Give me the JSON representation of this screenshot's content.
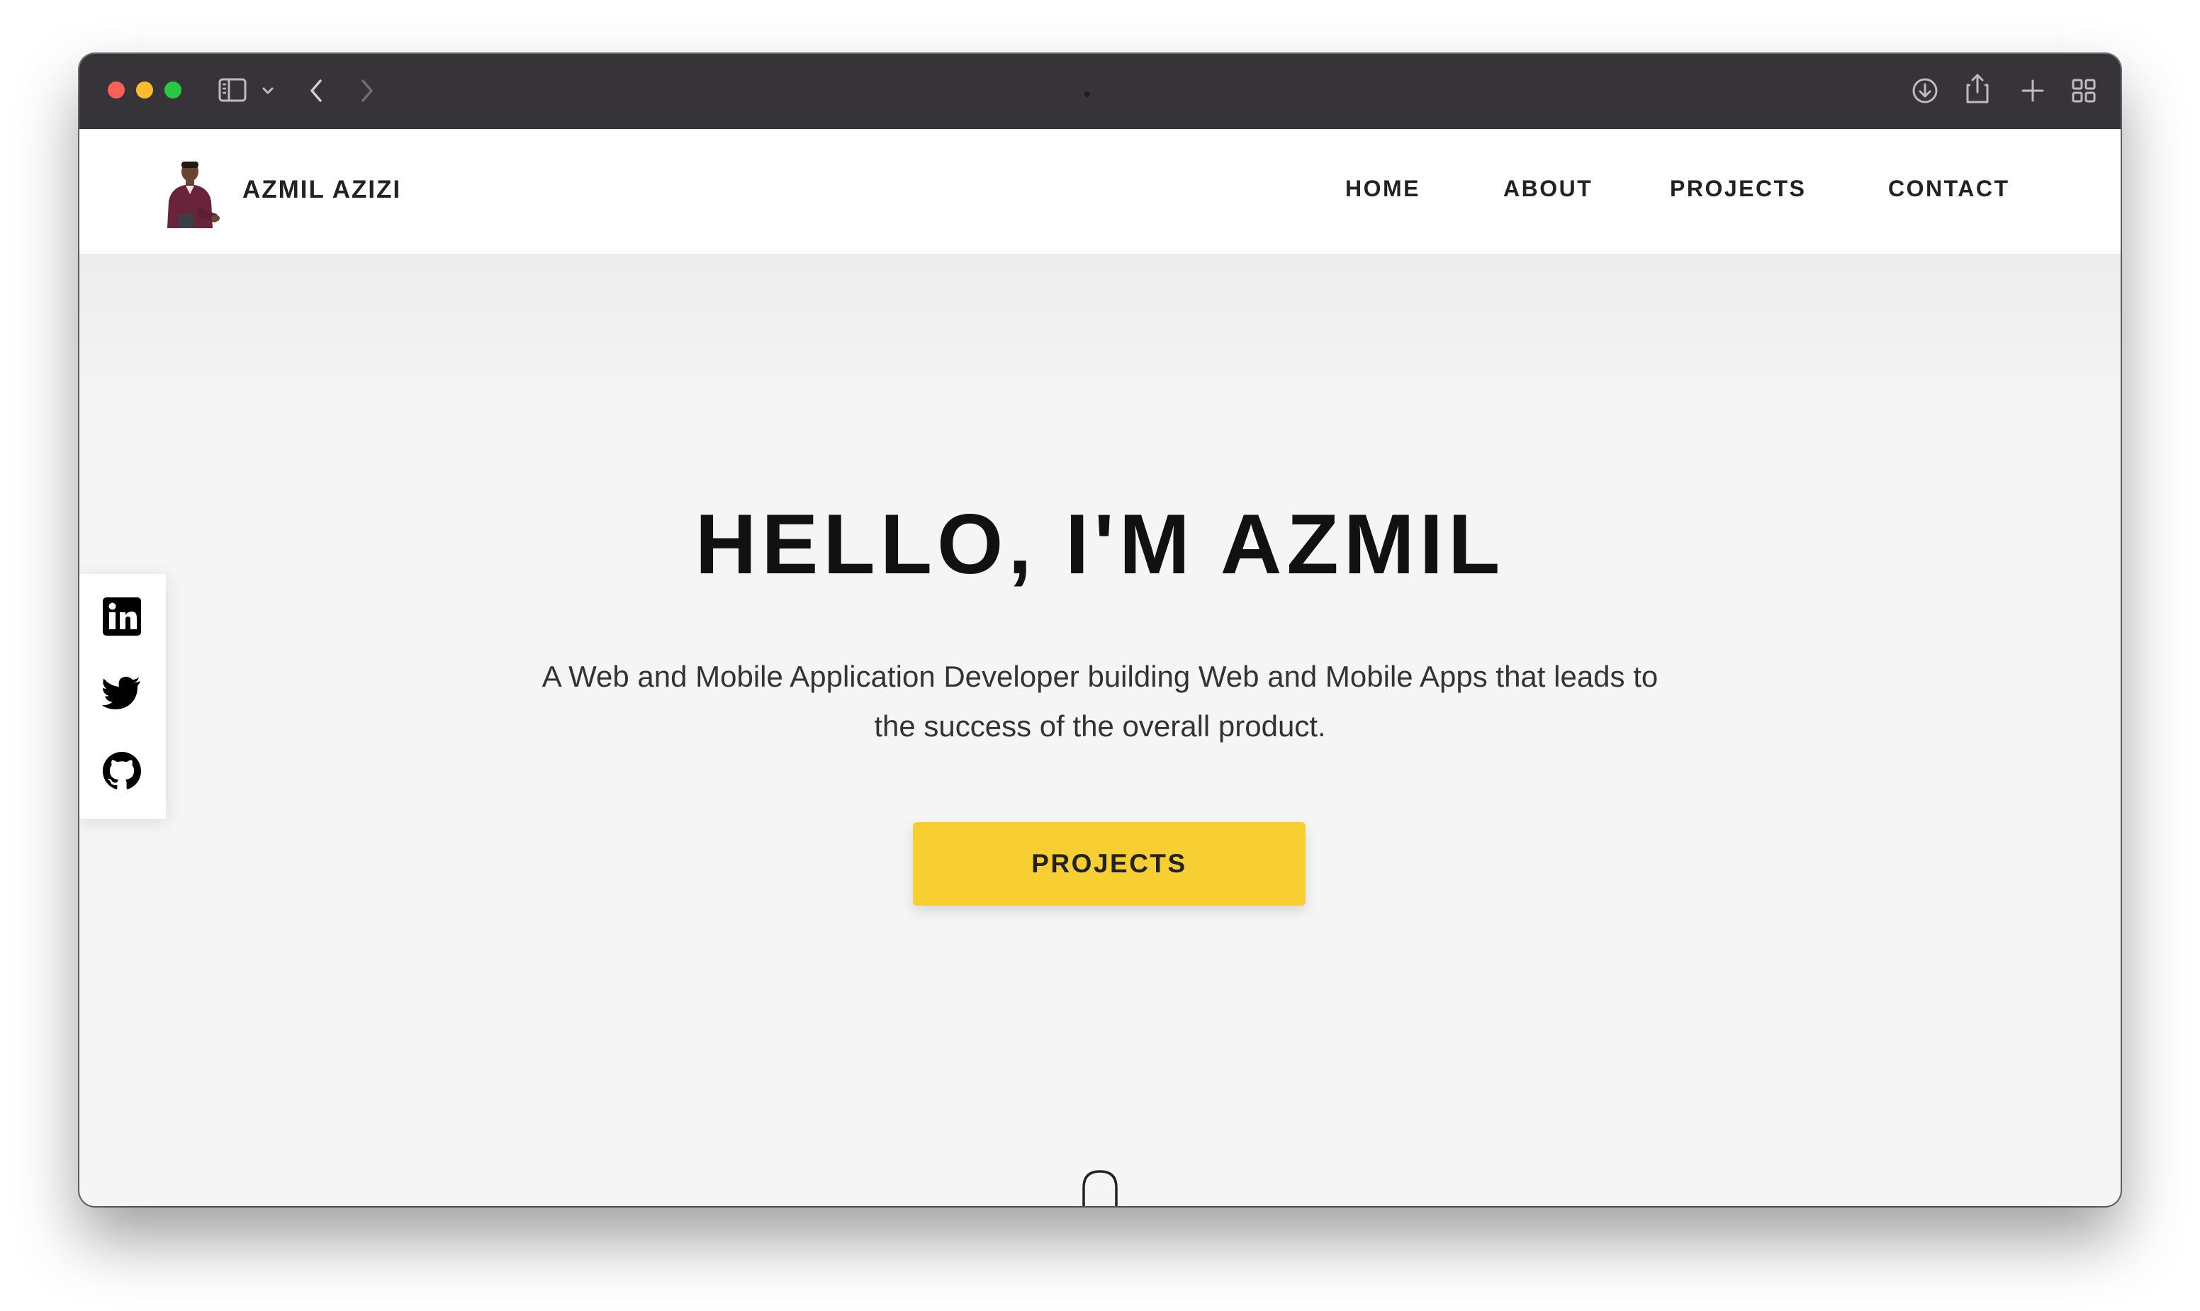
{
  "colors": {
    "toolbar": "#363438",
    "page_background": "#f5f5f5",
    "header_background": "#ffffff",
    "accent_button": "#f8cf32",
    "text_dark": "#111111"
  },
  "browser": {
    "toolbar_icons": [
      "sidebar-toggle-icon",
      "chevron-down-icon",
      "back-arrow-icon",
      "forward-arrow-icon",
      "download-icon",
      "share-icon",
      "new-tab-plus-icon",
      "tab-overview-icon"
    ]
  },
  "header": {
    "brand_name": "AZMIL AZIZI",
    "nav": {
      "home": "HOME",
      "about": "ABOUT",
      "projects": "PROJECTS",
      "contact": "CONTACT"
    }
  },
  "hero": {
    "title": "HELLO, I'M AZMIL",
    "subtitle": "A Web and Mobile Application Developer building Web and Mobile Apps that leads to the success of the overall product.",
    "cta_label": "PROJECTS"
  },
  "social": {
    "icons": [
      "linkedin-icon",
      "twitter-icon",
      "github-icon"
    ]
  }
}
